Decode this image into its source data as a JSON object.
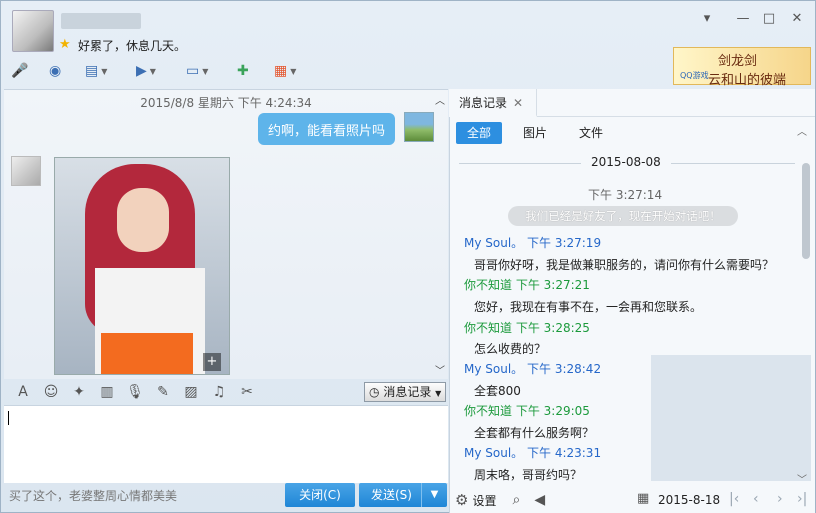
{
  "header": {
    "signature": "好累了，休息几天。",
    "star": "★",
    "ad": {
      "line1": "剑龙剑",
      "line2": "云和山的彼端",
      "brand": "QQ游戏"
    },
    "toolbar": [
      {
        "name": "mic-icon",
        "glyph": "🎤"
      },
      {
        "name": "camera-icon",
        "glyph": "◉"
      },
      {
        "name": "screen-share-icon",
        "glyph": "▤"
      },
      {
        "name": "folder-transfer-icon",
        "glyph": "▶"
      },
      {
        "name": "remote-desktop-icon",
        "glyph": "▭"
      },
      {
        "name": "add-chat-icon",
        "glyph": "✚"
      },
      {
        "name": "apps-grid-icon",
        "glyph": "▦"
      }
    ]
  },
  "chat": {
    "date_header": "2015/8/8 星期六 下午 4:24:34",
    "my_message": "约啊，能看看照片吗",
    "photo_zoom": "+"
  },
  "input_toolbar": {
    "history_label": "消息记录",
    "icons": [
      "font-icon",
      "emoji-icon",
      "shake-icon",
      "crop-icon",
      "voice-icon",
      "edit-icon",
      "image-icon",
      "music-icon",
      "scissors-icon"
    ],
    "glyphs": [
      "A",
      "☺",
      "✦",
      "▥",
      "🎙",
      "✎",
      "▨",
      "♫",
      "✂"
    ]
  },
  "footer": {
    "status_text": "买了这个，老婆整周心情都美美",
    "close_label": "关闭(C)",
    "send_label": "发送(S)",
    "send_dropdown": "▼"
  },
  "side": {
    "tab_label": "消息记录",
    "tab_close": "✕",
    "filters": [
      "全部",
      "图片",
      "文件"
    ],
    "date": "2015-08-08",
    "system_time": "下午 3:27:14",
    "system_message": "我们已经是好友了，现在开始对话吧！",
    "messages": [
      {
        "sender": "My Soul。",
        "time": "下午 3:27:19",
        "text": "哥哥你好呀，我是做兼职服务的，请问你有什么需要吗？",
        "me": true
      },
      {
        "sender": "你不知道",
        "time": "下午 3:27:21",
        "text": "您好，我现在有事不在，一会再和您联系。",
        "me": false
      },
      {
        "sender": "你不知道",
        "time": "下午 3:28:25",
        "text": "怎么收费的？",
        "me": false
      },
      {
        "sender": "My Soul。",
        "time": "下午 3:28:42",
        "text": "全套800",
        "me": true
      },
      {
        "sender": "你不知道",
        "time": "下午 3:29:05",
        "text": "全套都有什么服务啊？",
        "me": false
      },
      {
        "sender": "My Soul。",
        "time": "下午 4:23:31",
        "text": "周末咯，哥哥约吗？",
        "me": true
      }
    ],
    "footer": {
      "settings_label": "设置",
      "date": "2015-8-18"
    }
  }
}
